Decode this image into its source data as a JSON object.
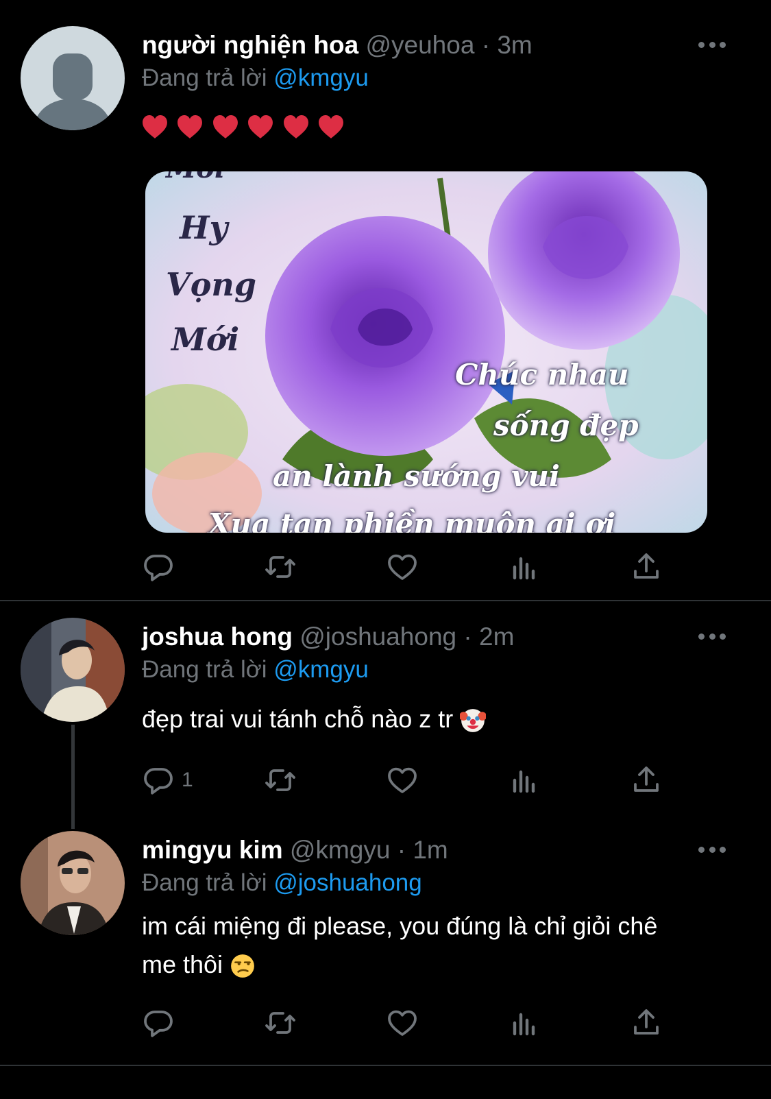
{
  "tweets": [
    {
      "display_name": "người nghiện hoa",
      "handle": "@yeuhoa",
      "dot": "·",
      "time": "3m",
      "reply_label": "Đang trả lời",
      "reply_to": "@kmgyu",
      "text_emoji": "red-heart x6",
      "media": {
        "lines": [
          "Mới",
          "Hy",
          "Vọng",
          "Mới",
          "Chúc nhau",
          "sống đẹp",
          "an lành sướng vui",
          "Xua tan phiền muộn ai ơi"
        ]
      },
      "actions": {
        "reply_count": "",
        "retweet_count": "",
        "like_count": ""
      }
    },
    {
      "display_name": "joshua hong",
      "handle": "@joshuahong",
      "dot": "·",
      "time": "2m",
      "reply_label": "Đang trả lời",
      "reply_to": "@kmgyu",
      "text": "đẹp trai vui tánh chỗ nào z tr",
      "text_emoji": "clown-face",
      "actions": {
        "reply_count": "1",
        "retweet_count": "",
        "like_count": ""
      }
    },
    {
      "display_name": "mingyu kim",
      "handle": "@kmgyu",
      "dot": "·",
      "time": "1m",
      "reply_label": "Đang trả lời",
      "reply_to": "@joshuahong",
      "text_line1": "im cái miệng đi please, you đúng là chỉ giỏi chê",
      "text_line2": "me thôi",
      "text_emoji": "unamused-face",
      "actions": {
        "reply_count": "",
        "retweet_count": "",
        "like_count": ""
      }
    }
  ],
  "colors": {
    "background": "#000000",
    "text": "#ffffff",
    "muted": "#71767b",
    "link": "#1d9bf0",
    "divider": "#2f3336"
  },
  "icons": [
    "more-icon",
    "reply-icon",
    "retweet-icon",
    "like-icon",
    "analytics-icon",
    "share-icon"
  ]
}
